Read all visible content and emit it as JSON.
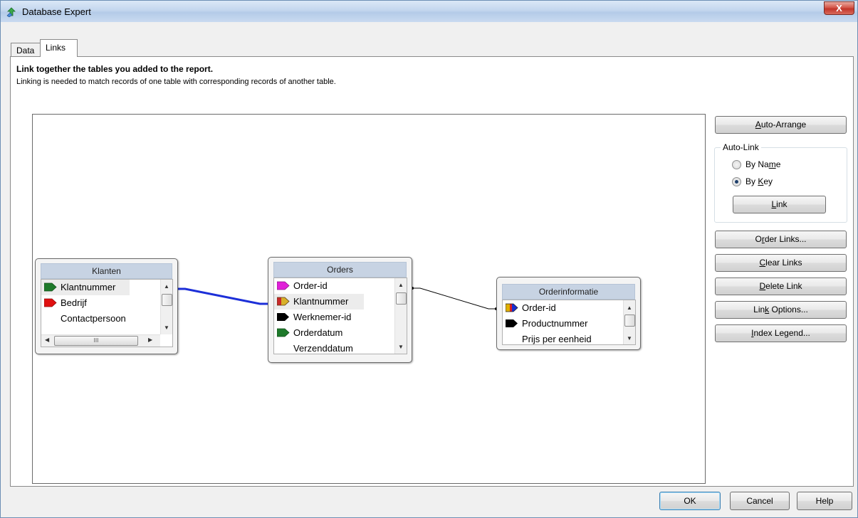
{
  "window": {
    "title": "Database Expert",
    "close_symbol": "X"
  },
  "tabs": [
    {
      "label": "Data",
      "active": false
    },
    {
      "label": "Links",
      "active": true
    }
  ],
  "page": {
    "heading": "Link together the tables you added to the report.",
    "subheading": "Linking is needed to match records of one table with corresponding records of another table."
  },
  "tables": {
    "klanten": {
      "title": "Klanten",
      "fields": [
        {
          "name": "Klantnummer",
          "key_color": "#1e7a2b"
        },
        {
          "name": "Bedrijf",
          "key_color": "#e01010"
        },
        {
          "name": "Contactpersoon",
          "key_color": ""
        }
      ],
      "hscroll_glyph": "III"
    },
    "orders": {
      "title": "Orders",
      "fields": [
        {
          "name": "Order-id",
          "key_color": "#e020d8"
        },
        {
          "name": "Klantnummer",
          "key_color": "#d09a2a"
        },
        {
          "name": "Werknemer-id",
          "key_color": "#000000"
        },
        {
          "name": "Orderdatum",
          "key_color": "#1e7a2b"
        },
        {
          "name": "Verzenddatum",
          "key_color": ""
        }
      ]
    },
    "orderinformatie": {
      "title": "Orderinformatie",
      "fields": [
        {
          "name": "Order-id",
          "key_color": "#e0b000"
        },
        {
          "name": "Productnummer",
          "key_color": "#000000"
        },
        {
          "name": "Prijs per eenheid",
          "key_color": ""
        }
      ]
    }
  },
  "links": {
    "selected_color": "#1c2fd8",
    "normal_color": "#000000"
  },
  "side_buttons": {
    "auto_arrange": {
      "pre": "",
      "u": "A",
      "post": "uto-Arrange"
    },
    "order_links": {
      "pre": "O",
      "u": "r",
      "post": "der Links..."
    },
    "clear_links": {
      "pre": "",
      "u": "C",
      "post": "lear Links"
    },
    "delete_link": {
      "pre": "",
      "u": "D",
      "post": "elete Link"
    },
    "link_options": {
      "pre": "Lin",
      "u": "k",
      "post": " Options..."
    },
    "index_legend": {
      "pre": "",
      "u": "I",
      "post": "ndex Legend..."
    }
  },
  "auto_link": {
    "label": "Auto-Link",
    "by_name": {
      "pre": "By Na",
      "u": "m",
      "post": "e",
      "checked": false
    },
    "by_key": {
      "pre": "By ",
      "u": "K",
      "post": "ey",
      "checked": true
    },
    "link_button": {
      "pre": "",
      "u": "L",
      "post": "ink"
    }
  },
  "footer": {
    "ok": "OK",
    "cancel": "Cancel",
    "help": "Help"
  }
}
